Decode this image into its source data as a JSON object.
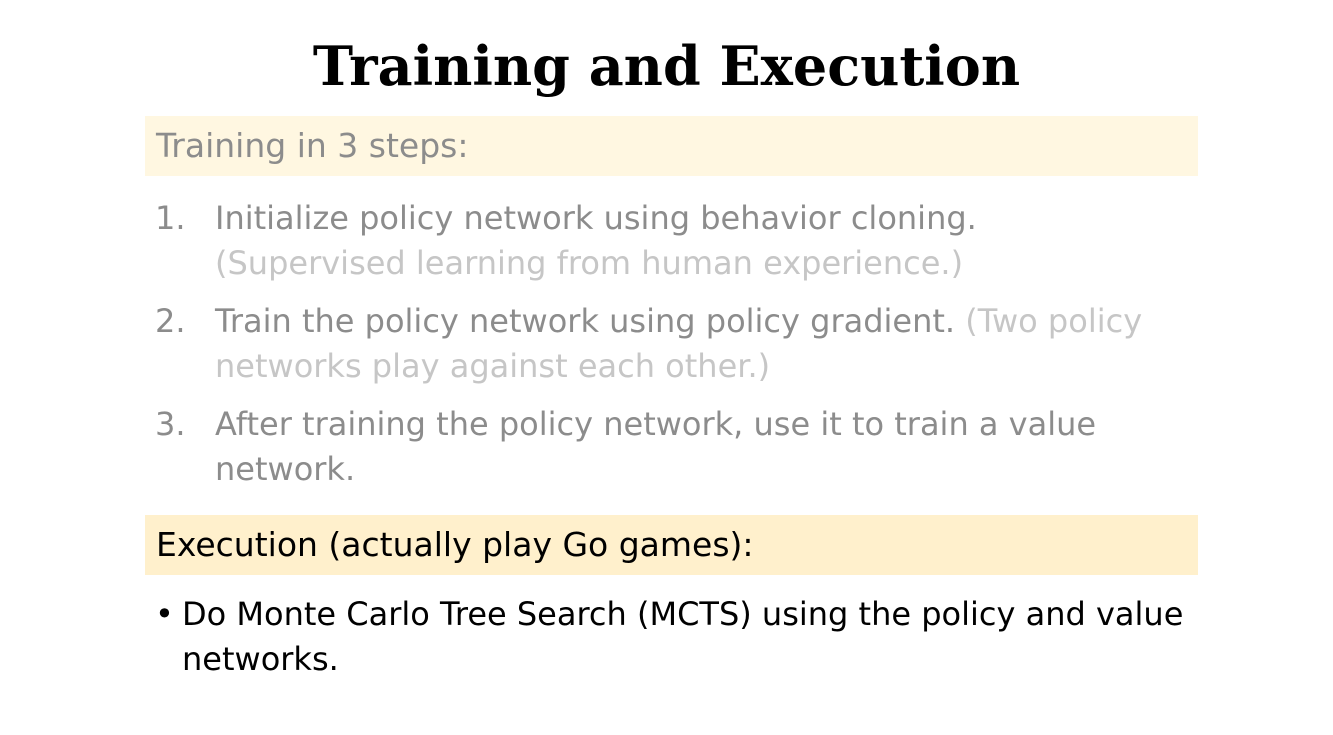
{
  "title": "Training and Execution",
  "training": {
    "heading": "Training in 3 steps:",
    "steps": [
      {
        "number": "1.",
        "text": "Initialize policy network using behavior cloning.",
        "note": "(Supervised learning from human experience.)"
      },
      {
        "number": "2.",
        "text": "Train the policy network using policy gradient.",
        "note": "(Two policy networks play against each other.)"
      },
      {
        "number": "3.",
        "text": "After training the policy network, use it to train a value network.",
        "note": ""
      }
    ]
  },
  "execution": {
    "heading": "Execution (actually play Go games):",
    "bullets": [
      {
        "marker": "•",
        "text": "Do Monte Carlo Tree Search (MCTS) using the policy and value networks."
      }
    ]
  },
  "colors": {
    "training_band": "#fff7e1",
    "execution_band": "#fff0cc",
    "muted_text": "#8c8c8c",
    "faint_text": "#c6c6c6"
  }
}
